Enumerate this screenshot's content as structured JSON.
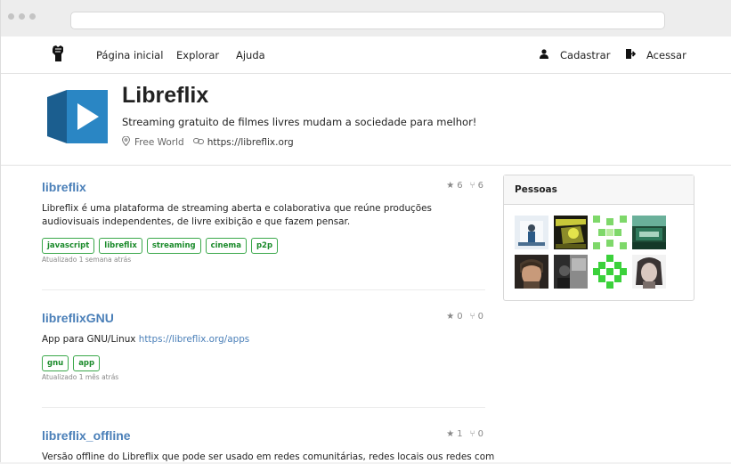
{
  "nav": {
    "home": "Página inicial",
    "explore": "Explorar",
    "help": "Ajuda",
    "register": "Cadastrar",
    "login": "Acessar"
  },
  "org": {
    "name": "Libreflix",
    "description": "Streaming gratuito de filmes livres mudam a sociedade para melhor!",
    "location": "Free World",
    "website": "https://libreflix.org"
  },
  "repos": [
    {
      "name": "libreflix",
      "stars": "6",
      "forks": "6",
      "description": "Libreflix é uma plataforma de streaming aberta e colaborativa que reúne produções audiovisuais independentes, de livre exibição e que fazem pensar.",
      "link": "",
      "tags": [
        "javascript",
        "libreflix",
        "streaming",
        "cinema",
        "p2p"
      ],
      "updated": "Atualizado 1 semana atrás"
    },
    {
      "name": "libreflixGNU",
      "stars": "0",
      "forks": "0",
      "description": "App para GNU/Linux ",
      "link": "https://libreflix.org/apps",
      "tags": [
        "gnu",
        "app"
      ],
      "updated": "Atualizado 1 mês atrás"
    },
    {
      "name": "libreflix_offline",
      "stars": "1",
      "forks": "0",
      "description": "Versão offline do Libreflix que pode ser usado em redes comunitárias, redes locais ous redes com",
      "link": "",
      "tags": [],
      "updated": ""
    }
  ],
  "people": {
    "title": "Pessoas"
  },
  "colors": {
    "link": "#4a7fb8",
    "tag": "#1a8a2a",
    "logo_blue": "#2a7fb8"
  }
}
